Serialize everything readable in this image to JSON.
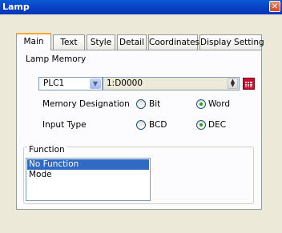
{
  "window": {
    "title": "Lamp",
    "close_icon": "close-icon"
  },
  "tabs": [
    {
      "label": "Main",
      "active": true
    },
    {
      "label": "Text",
      "active": false
    },
    {
      "label": "Style",
      "active": false
    },
    {
      "label": "Detail",
      "active": false
    },
    {
      "label": "Coordinates",
      "active": false
    },
    {
      "label": "Display Setting",
      "active": false
    }
  ],
  "lamp_memory": {
    "label": "Lamp Memory",
    "plc_select": "PLC1",
    "address": "1:D0000"
  },
  "memory_designation": {
    "label": "Memory Designation",
    "options": [
      "Bit",
      "Word"
    ],
    "selected": "Word"
  },
  "input_type": {
    "label": "Input Type",
    "options": [
      "BCD",
      "DEC"
    ],
    "selected": "DEC"
  },
  "function": {
    "label": "Function",
    "items": [
      "No Function",
      "Mode"
    ],
    "selected": "No Function"
  },
  "colors": {
    "title_bar": "#0a3fc4",
    "selection": "#316ac5",
    "radio_dot": "#21a121"
  }
}
